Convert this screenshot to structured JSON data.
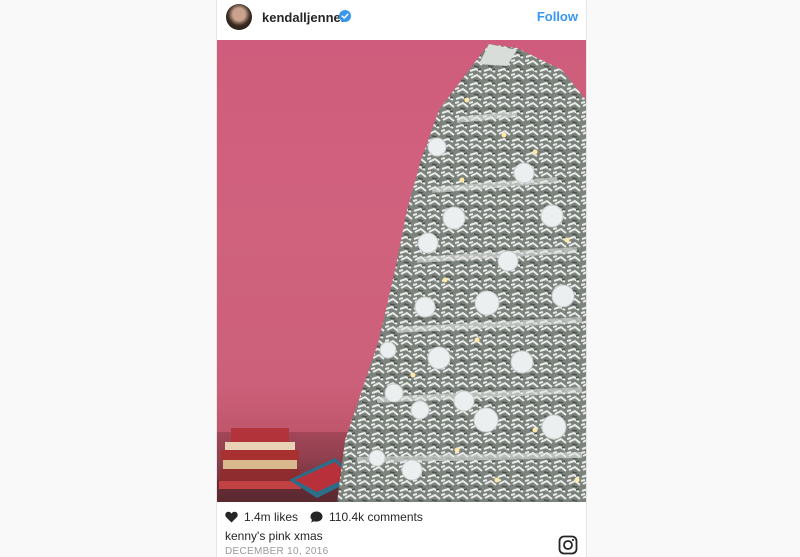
{
  "post": {
    "username": "kendalljenner",
    "follow_label": "Follow",
    "likes": "1.4m likes",
    "comments": "110.4k comments",
    "caption": "kenny's pink xmas",
    "date": "DECEMBER 10, 2016"
  },
  "colors": {
    "accent": "#3897f0",
    "wall": "#cf5c7c",
    "text": "#262626",
    "muted": "#999999"
  },
  "icons": {
    "verified": "verified-badge-icon",
    "like": "heart-icon",
    "comment": "comment-bubble-icon",
    "brand": "instagram-icon"
  }
}
